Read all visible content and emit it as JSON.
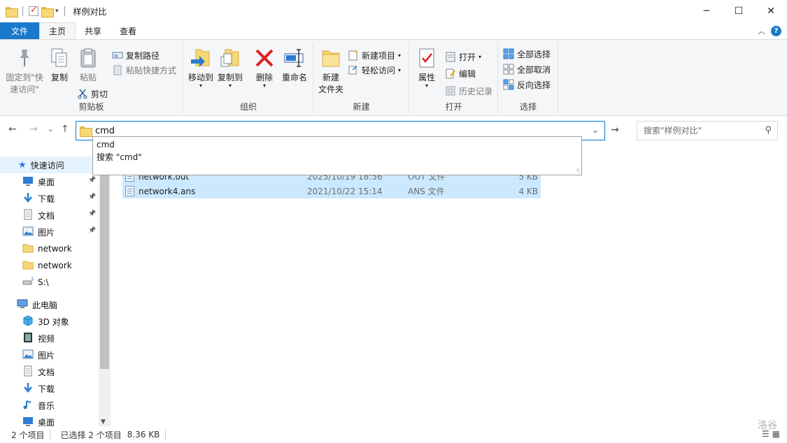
{
  "window": {
    "title": "样例对比",
    "minimize": "─",
    "maximize": "☐",
    "close": "✕"
  },
  "tabs": [
    "文件",
    "主页",
    "共享",
    "查看"
  ],
  "ribbon": {
    "clipboard": {
      "label": "剪贴板",
      "pin": [
        "固定到\"快",
        "速访问\""
      ],
      "copy": "复制",
      "paste": "粘贴",
      "copy_path": "复制路径",
      "paste_shortcut": "粘贴快捷方式",
      "cut": "剪切"
    },
    "organize": {
      "label": "组织",
      "move_to": "移动到",
      "copy_to": "复制到",
      "delete": "删除",
      "rename": "重命名"
    },
    "new": {
      "label": "新建",
      "new_folder": [
        "新建",
        "文件夹"
      ],
      "new_item": "新建项目",
      "easy_access": "轻松访问"
    },
    "open": {
      "label": "打开",
      "properties": "属性",
      "open": "打开",
      "edit": "编辑",
      "history": "历史记录"
    },
    "select": {
      "label": "选择",
      "select_all": "全部选择",
      "select_none": "全部取消",
      "invert": "反向选择"
    }
  },
  "address": {
    "value": "cmd",
    "suggestions": [
      "cmd",
      "搜索 \"cmd\""
    ]
  },
  "search": {
    "placeholder": "搜索\"样例对比\""
  },
  "nav": {
    "quick_access": "快速访问",
    "items": [
      {
        "label": "桌面",
        "icon": "desktop-icon",
        "pinned": true
      },
      {
        "label": "下载",
        "icon": "download-icon",
        "pinned": true
      },
      {
        "label": "文档",
        "icon": "document-icon",
        "pinned": true
      },
      {
        "label": "图片",
        "icon": "picture-icon",
        "pinned": true
      },
      {
        "label": "network",
        "icon": "folder-icon",
        "pinned": false
      },
      {
        "label": "network",
        "icon": "folder-icon",
        "pinned": false
      },
      {
        "label": "S:\\",
        "icon": "network-drive-icon",
        "pinned": false
      }
    ],
    "this_pc": "此电脑",
    "pc_items": [
      {
        "label": "3D 对象",
        "icon": "3d-objects-icon"
      },
      {
        "label": "视频",
        "icon": "video-icon"
      },
      {
        "label": "图片",
        "icon": "picture-icon"
      },
      {
        "label": "文档",
        "icon": "document-icon"
      },
      {
        "label": "下载",
        "icon": "download-icon"
      },
      {
        "label": "音乐",
        "icon": "music-icon"
      },
      {
        "label": "桌面",
        "icon": "desktop-icon"
      }
    ]
  },
  "files": [
    {
      "name": "network.out",
      "date": "2025/10/19 18:56",
      "type": "OUT 文件",
      "size": "5 KB"
    },
    {
      "name": "network4.ans",
      "date": "2021/10/22 15:14",
      "type": "ANS 文件",
      "size": "4 KB"
    }
  ],
  "status": {
    "count": "2 个项目",
    "selected": "已选择 2 个项目",
    "size": "8.36 KB"
  },
  "watermark": "洛谷",
  "colors": {
    "accent": "#1979ca",
    "selection": "#cce8ff",
    "ribbon_bg": "#f5f6f7"
  }
}
